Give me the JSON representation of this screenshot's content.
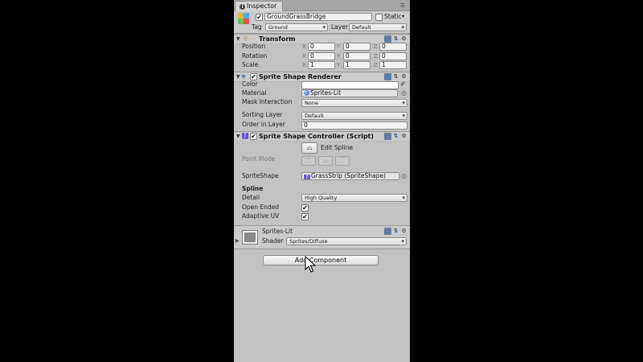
{
  "inspector": {
    "tab_label": "Inspector",
    "info_glyph": "i",
    "menu_glyph": "☰"
  },
  "header": {
    "active_checked": true,
    "object_name": "GroundGrassBridge",
    "static_label": "Static",
    "tag_label": "Tag",
    "tag_value": "Ground",
    "layer_label": "Layer",
    "layer_value": "Default"
  },
  "transform": {
    "title": "Transform",
    "rows": [
      {
        "label": "Position",
        "x": "0",
        "y": "0",
        "z": "0"
      },
      {
        "label": "Rotation",
        "x": "0",
        "y": "0",
        "z": "0"
      },
      {
        "label": "Scale",
        "x": "1",
        "y": "1",
        "z": "1"
      }
    ],
    "axis": {
      "x": "X",
      "y": "Y",
      "z": "Z"
    }
  },
  "renderer": {
    "title": "Sprite Shape Renderer",
    "enabled": true,
    "color_label": "Color",
    "material_label": "Material",
    "material_value": "Sprites-Lit",
    "mask_label": "Mask Interaction",
    "mask_value": "None",
    "sorting_label": "Sorting Layer",
    "sorting_value": "Default",
    "order_label": "Order in Layer",
    "order_value": "0"
  },
  "controller": {
    "title": "Sprite Shape Controller (Script)",
    "enabled": true,
    "edit_spline_label": "Edit Spline",
    "point_mode_label": "Point Mode",
    "spriteshape_label": "SpriteShape",
    "spriteshape_value": "GrassStrip (SpriteShape)",
    "spline_heading": "Spline",
    "detail_label": "Detail",
    "detail_value": "High Quality",
    "open_ended_label": "Open Ended",
    "open_ended_checked": true,
    "adaptive_uv_label": "Adaptive UV",
    "adaptive_uv_checked": true
  },
  "material": {
    "name": "Sprites-Lit",
    "shader_label": "Shader",
    "shader_value": "Sprites/Diffuse"
  },
  "add_component_label": "Add Component",
  "icon_glyphs": {
    "checkmark": "✔",
    "gear": "⚙",
    "eyedropper": "✐",
    "target": "◎"
  },
  "colors": {
    "panel_bg": "#c2c2c2",
    "header_bg": "#cbcbcb",
    "icon_blue": "#5d7ea8"
  }
}
